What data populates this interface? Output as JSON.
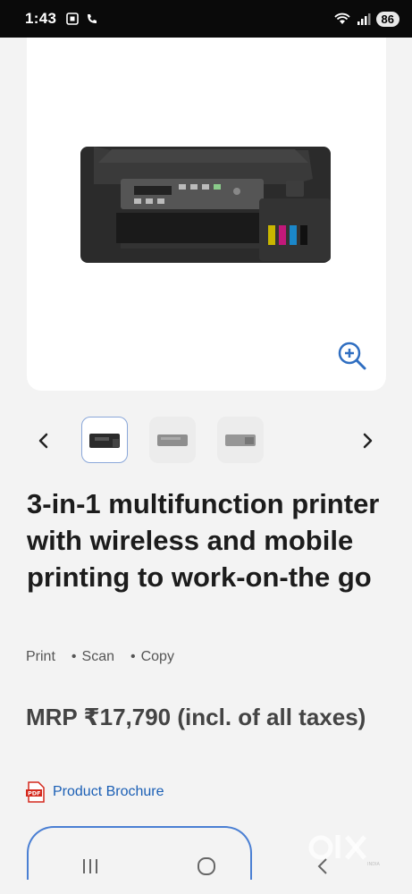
{
  "status_bar": {
    "time": "1:43",
    "battery": "86"
  },
  "product": {
    "title": "3-in-1 multifunction printer with wireless and mobile printing to work-on-the go",
    "features": [
      "Print",
      "Scan",
      "Copy"
    ],
    "price": "MRP ₹17,790 (incl. of all taxes)",
    "brochure_label": "Product Brochure"
  },
  "gallery": {
    "thumbnail_count": 3,
    "active_index": 0
  },
  "colors": {
    "link_blue": "#1b5fb5",
    "accent_outline": "#4a7fd3",
    "zoom_icon": "#2f6ec1",
    "pdf_red": "#d4281c"
  },
  "icons": [
    "wifi-icon",
    "signal-icon",
    "zoom-in-icon",
    "chevron-left-icon",
    "chevron-right-icon",
    "pdf-icon",
    "recent-apps-icon",
    "home-icon",
    "back-icon"
  ]
}
